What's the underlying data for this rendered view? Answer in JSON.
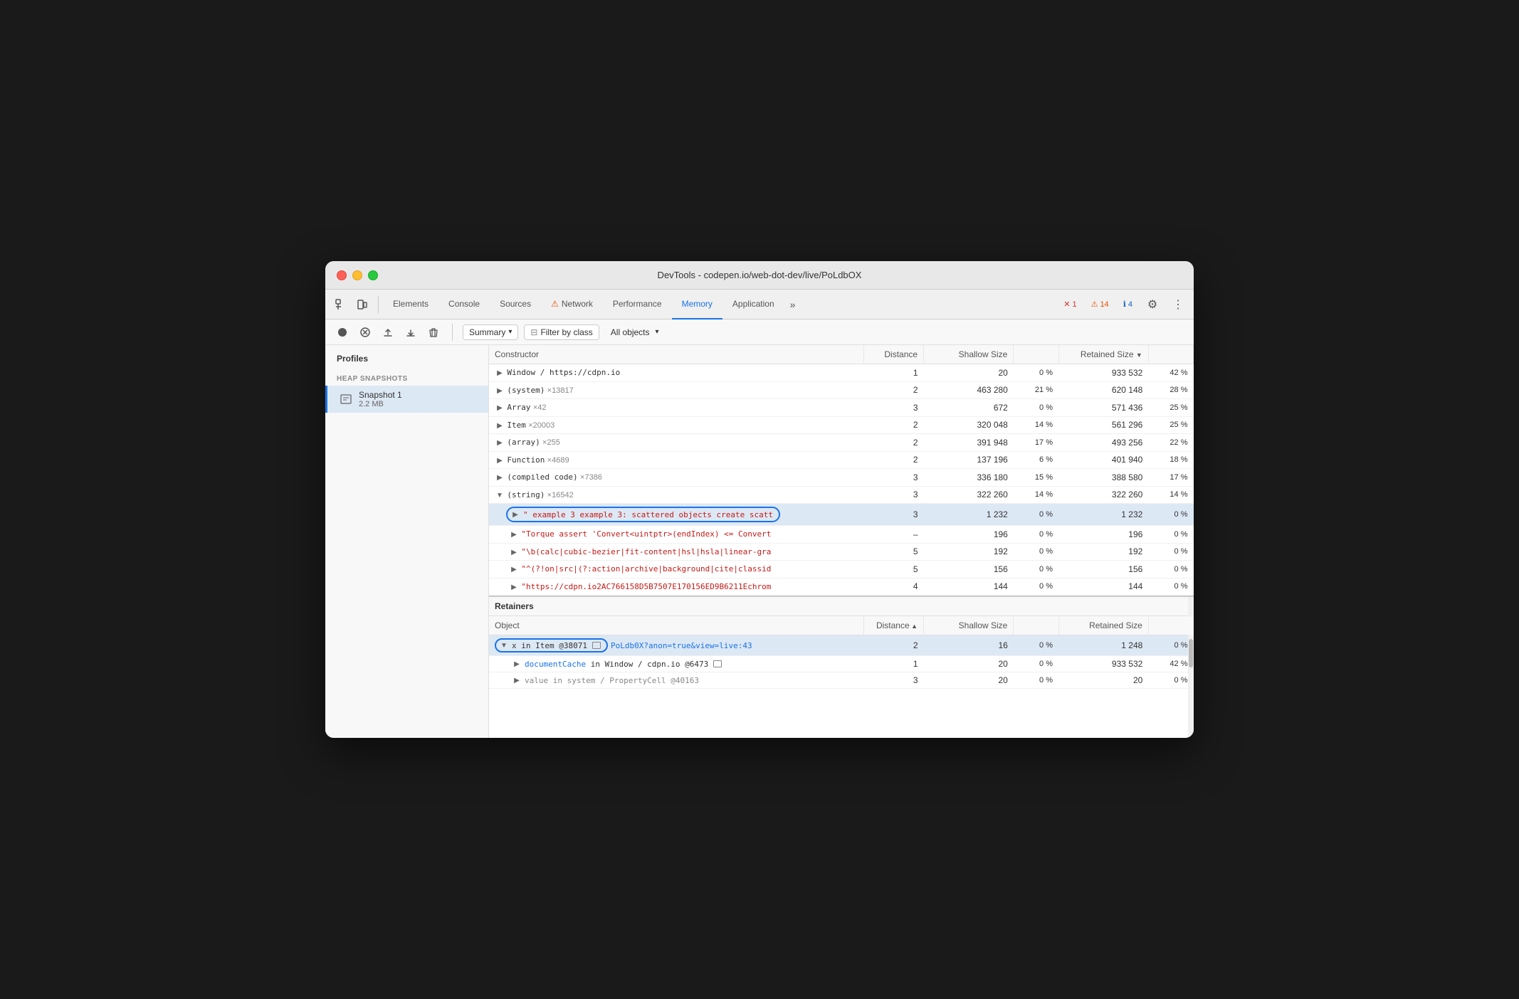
{
  "window": {
    "title": "DevTools - codepen.io/web-dot-dev/live/PoLdbOX"
  },
  "tabs": {
    "items": [
      {
        "label": "Elements",
        "active": false
      },
      {
        "label": "Console",
        "active": false
      },
      {
        "label": "Sources",
        "active": false
      },
      {
        "label": "Network",
        "active": false,
        "warning": true
      },
      {
        "label": "Performance",
        "active": false
      },
      {
        "label": "Memory",
        "active": true
      },
      {
        "label": "Application",
        "active": false
      }
    ],
    "more_label": "»",
    "badges": {
      "errors": {
        "count": "1",
        "icon": "✕"
      },
      "warnings": {
        "count": "14",
        "icon": "⚠"
      },
      "info": {
        "count": "4",
        "icon": "ℹ"
      }
    }
  },
  "toolbar": {
    "summary_label": "Summary",
    "filter_label": "Filter by class",
    "all_objects_label": "All objects"
  },
  "sidebar": {
    "title": "Profiles",
    "section_title": "HEAP SNAPSHOTS",
    "snapshot": {
      "name": "Snapshot 1",
      "size": "2.2 MB"
    }
  },
  "constructor_table": {
    "headers": [
      "Constructor",
      "Distance",
      "Shallow Size",
      "",
      "Retained Size",
      ""
    ],
    "rows": [
      {
        "constructor": "Window / https://cdpn.io",
        "distance": "1",
        "shallow_size": "20",
        "shallow_pct": "0 %",
        "retained_size": "933 532",
        "retained_pct": "42 %",
        "expanded": false,
        "indent": 0
      },
      {
        "constructor": "(system)",
        "count": "×13817",
        "distance": "2",
        "shallow_size": "463 280",
        "shallow_pct": "21 %",
        "retained_size": "620 148",
        "retained_pct": "28 %",
        "expanded": false,
        "indent": 0
      },
      {
        "constructor": "Array",
        "count": "×42",
        "distance": "3",
        "shallow_size": "672",
        "shallow_pct": "0 %",
        "retained_size": "571 436",
        "retained_pct": "25 %",
        "expanded": false,
        "indent": 0
      },
      {
        "constructor": "Item",
        "count": "×20003",
        "distance": "2",
        "shallow_size": "320 048",
        "shallow_pct": "14 %",
        "retained_size": "561 296",
        "retained_pct": "25 %",
        "expanded": false,
        "indent": 0
      },
      {
        "constructor": "(array)",
        "count": "×255",
        "distance": "2",
        "shallow_size": "391 948",
        "shallow_pct": "17 %",
        "retained_size": "493 256",
        "retained_pct": "22 %",
        "expanded": false,
        "indent": 0
      },
      {
        "constructor": "Function",
        "count": "×4689",
        "distance": "2",
        "shallow_size": "137 196",
        "shallow_pct": "6 %",
        "retained_size": "401 940",
        "retained_pct": "18 %",
        "expanded": false,
        "indent": 0
      },
      {
        "constructor": "(compiled code)",
        "count": "×7386",
        "distance": "3",
        "shallow_size": "336 180",
        "shallow_pct": "15 %",
        "retained_size": "388 580",
        "retained_pct": "17 %",
        "expanded": false,
        "indent": 0
      },
      {
        "constructor": "(string)",
        "count": "×16542",
        "distance": "3",
        "shallow_size": "322 260",
        "shallow_pct": "14 %",
        "retained_size": "322 260",
        "retained_pct": "14 %",
        "expanded": true,
        "indent": 0
      },
      {
        "constructor": "\" example 3 example 3: scattered objects create scatt",
        "distance": "3",
        "shallow_size": "1 232",
        "shallow_pct": "0 %",
        "retained_size": "1 232",
        "retained_pct": "0 %",
        "expanded": false,
        "indent": 1,
        "is_string": true,
        "highlighted": true
      },
      {
        "constructor": "\"Torque assert 'Convert<uintptr>(endIndex) <= Convert",
        "distance": "–",
        "shallow_size": "196",
        "shallow_pct": "0 %",
        "retained_size": "196",
        "retained_pct": "0 %",
        "expanded": false,
        "indent": 1,
        "is_string": true
      },
      {
        "constructor": "\"\\b(calc|cubic-bezier|fit-content|hsl|hsla|linear-gra",
        "distance": "5",
        "shallow_size": "192",
        "shallow_pct": "0 %",
        "retained_size": "192",
        "retained_pct": "0 %",
        "expanded": false,
        "indent": 1,
        "is_string": true
      },
      {
        "constructor": "\"^(?!on|src|(?:action|archive|background|cite|classid",
        "distance": "5",
        "shallow_size": "156",
        "shallow_pct": "0 %",
        "retained_size": "156",
        "retained_pct": "0 %",
        "expanded": false,
        "indent": 1,
        "is_string": true
      },
      {
        "constructor": "\"https://cdpn.io2AC766158D5B7507E170156ED9B6211Echrom",
        "distance": "4",
        "shallow_size": "144",
        "shallow_pct": "0 %",
        "retained_size": "144",
        "retained_pct": "0 %",
        "expanded": false,
        "indent": 1,
        "is_string": true
      }
    ]
  },
  "retainers_table": {
    "section_title": "Retainers",
    "headers": [
      "Object",
      "Distance ▲",
      "Shallow Size",
      "",
      "Retained Size",
      ""
    ],
    "rows": [
      {
        "object": "x in Item @38071",
        "link": "PoLdb0X?anon=true&view=live:43",
        "distance": "2",
        "shallow_size": "16",
        "shallow_pct": "0 %",
        "retained_size": "1 248",
        "retained_pct": "0 %",
        "expanded": true,
        "highlighted": true,
        "indent": 0
      },
      {
        "object": "documentCache in Window / cdpn.io @6473",
        "distance": "1",
        "shallow_size": "20",
        "shallow_pct": "0 %",
        "retained_size": "933 532",
        "retained_pct": "42 %",
        "expanded": false,
        "indent": 1
      },
      {
        "object": "value in system / PropertyCell @40163",
        "distance": "3",
        "shallow_size": "20",
        "shallow_pct": "0 %",
        "retained_size": "20",
        "retained_pct": "0 %",
        "expanded": false,
        "indent": 1,
        "grayed": true
      }
    ]
  }
}
